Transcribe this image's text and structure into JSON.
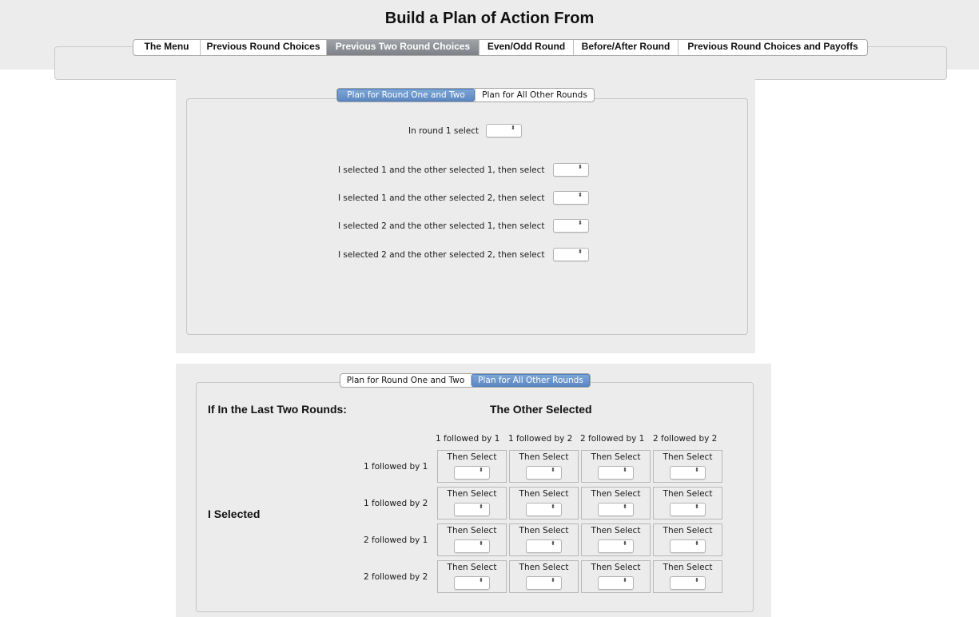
{
  "page_title": "Build a Plan of Action From",
  "top_tabs": [
    {
      "label": "The Menu",
      "active": false
    },
    {
      "label": "Previous Round Choices",
      "active": false
    },
    {
      "label": "Previous Two Round Choices",
      "active": true
    },
    {
      "label": "Even/Odd Round",
      "active": false
    },
    {
      "label": "Before/After Round",
      "active": false
    },
    {
      "label": "Previous Round Choices and Payoffs",
      "active": false
    }
  ],
  "panel1": {
    "tabs": [
      {
        "label": "Plan for Round One and Two",
        "active": true
      },
      {
        "label": "Plan for All Other Rounds",
        "active": false
      }
    ],
    "round1_label": "In round 1 select",
    "rows": [
      {
        "label": "I selected 1 and the other selected 1, then select"
      },
      {
        "label": "I selected 1 and the other selected 2, then select"
      },
      {
        "label": "I selected 2 and the other selected 1, then select"
      },
      {
        "label": "I selected 2 and the other selected 2, then select"
      }
    ]
  },
  "panel2": {
    "tabs": [
      {
        "label": "Plan for Round One and Two",
        "active": false
      },
      {
        "label": "Plan for All Other Rounds",
        "active": true
      }
    ],
    "left_heading": "If In the Last Two Rounds:",
    "top_heading": "The Other Selected",
    "row_heading": "I Selected",
    "columns": [
      "1 followed by 1",
      "1 followed by 2",
      "2 followed by 1",
      "2 followed by 2"
    ],
    "rows": [
      "1 followed by 1",
      "1 followed by 2",
      "2 followed by 1",
      "2 followed by 2"
    ],
    "cell_label": "Then Select"
  },
  "select_arrows": "⬍"
}
